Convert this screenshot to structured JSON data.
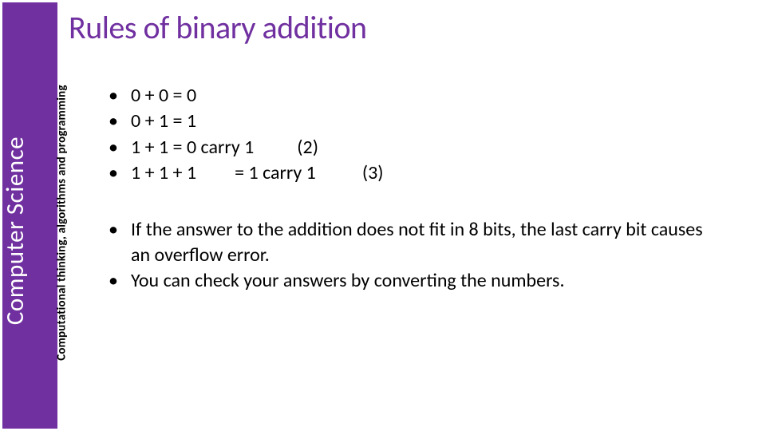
{
  "sidebar": {
    "title": "Computer Science",
    "subtitle": "Computational thinking, algorithms and programming"
  },
  "main": {
    "title": "Rules of binary addition",
    "rules": [
      {
        "text": "0 + 0 = 0",
        "note": ""
      },
      {
        "text": "0 + 1 = 1",
        "note": ""
      },
      {
        "text": "1 + 1 = 0 carry 1",
        "note": "(2)"
      },
      {
        "text": "1 + 1 + 1      = 1 carry 1",
        "note": "(3)"
      }
    ],
    "notes": [
      "If the answer to the addition does not fit in 8 bits, the last carry bit causes an overflow error.",
      "You can check your answers by converting the numbers."
    ]
  }
}
